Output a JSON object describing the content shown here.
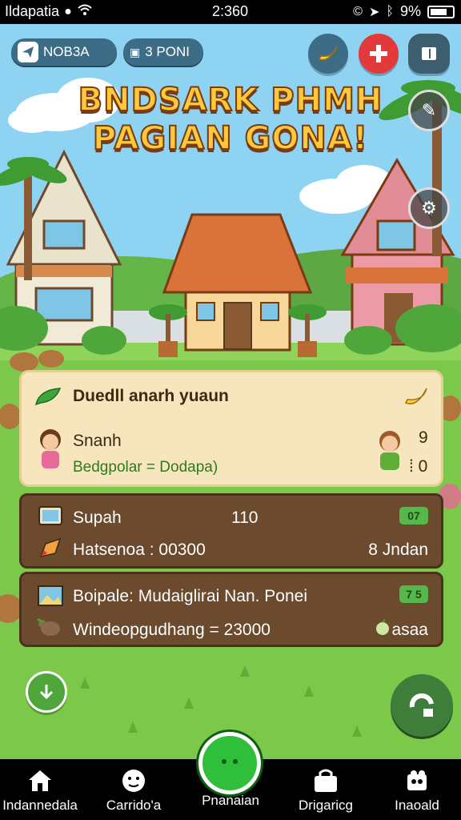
{
  "status_bar": {
    "carrier": "Ildapatia",
    "time": "2:360",
    "battery": "9%"
  },
  "hud": {
    "chip1": "NOB3A",
    "chip2": "3 PONI"
  },
  "title": {
    "line1": "BNDSARK PHMH",
    "line2": "PAGIAN GONA!"
  },
  "quest_panel": {
    "heading": "Duedll anarh yuaun",
    "character": "Snanh",
    "subtext": "Bedgpolar = Dodapa)",
    "counter_top": "9",
    "counter_bottom": "⁞ 0"
  },
  "panels": [
    {
      "title": "Supah",
      "value": "110",
      "badge": "07",
      "detail": "Hatsenoa : 00300",
      "detail_right": "8 Jndan"
    },
    {
      "title": "Boipale: Mudaiglirai Nan. Ponei",
      "badge": "7 5",
      "detail": "Windeopgudhang = 23000",
      "detail_right": "asaa"
    }
  ],
  "nav": {
    "items": [
      {
        "label": "Indannedala",
        "icon": "home-icon"
      },
      {
        "label": "Carrido'a",
        "icon": "face-icon"
      },
      {
        "label": "Pnanaian",
        "icon": "play-icon"
      },
      {
        "label": "Drigaricg",
        "icon": "bag-icon"
      },
      {
        "label": "Inaoald",
        "icon": "puzzle-icon"
      }
    ]
  },
  "colors": {
    "sky": "#8fd3f2",
    "grass": "#7cc84a",
    "title": "#ffc93a",
    "panel_dark": "#6b4a2e",
    "panel_light": "#f7e5bd",
    "badge_green": "#56b84a"
  }
}
